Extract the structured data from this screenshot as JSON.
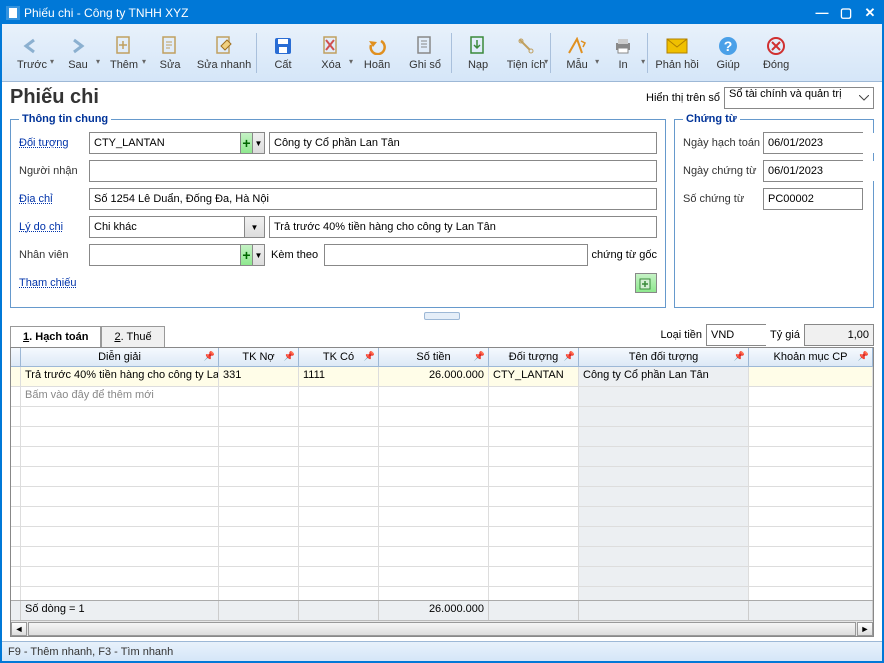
{
  "window": {
    "title": "Phiếu chi - Công ty TNHH XYZ"
  },
  "toolbar": {
    "prev": "Trước",
    "next": "Sau",
    "add": "Thêm",
    "edit": "Sửa",
    "quickedit": "Sửa nhanh",
    "cut": "Cất",
    "delete": "Xóa",
    "undo": "Hoãn",
    "post": "Ghi sổ",
    "load": "Nạp",
    "utility": "Tiện ích",
    "template": "Mẫu",
    "print": "In",
    "feedback": "Phản hồi",
    "help": "Giúp",
    "close": "Đóng"
  },
  "page": {
    "title": "Phiếu chi",
    "displayLabel": "Hiển thị trên sổ",
    "displayValue": "Sổ tài chính và quản trị"
  },
  "general": {
    "legend": "Thông tin chung",
    "subjectLabel": "Đối tượng",
    "subjectCode": "CTY_LANTAN",
    "subjectName": "Công ty Cổ phần Lan Tân",
    "receiverLabel": "Người nhận",
    "receiver": "",
    "addressLabel": "Địa chỉ",
    "address": "Số 1254 Lê Duẩn, Đống Đa, Hà Nội",
    "reasonLabel": "Lý do chi",
    "reasonCode": "Chi khác",
    "reasonText": "Trả trước 40% tiền hàng cho công ty Lan Tân",
    "employeeLabel": "Nhân viên",
    "employee": "",
    "attachLabel": "Kèm theo",
    "attachValue": "",
    "attachSuffix": "chứng từ gốc",
    "refLabel": "Tham chiếu"
  },
  "voucher": {
    "legend": "Chứng từ",
    "postDateLabel": "Ngày hạch toán",
    "postDate": "06/01/2023",
    "voucherDateLabel": "Ngày chứng từ",
    "voucherDate": "06/01/2023",
    "voucherNoLabel": "Số chứng từ",
    "voucherNo": "PC00002"
  },
  "tabs": {
    "tab1": "Hạch toán",
    "tab2": "Thuế",
    "acc1": "1",
    "acc2": "2"
  },
  "currency": {
    "label": "Loại tiền",
    "code": "VND",
    "rateLabel": "Tỷ giá",
    "rate": "1,00"
  },
  "grid": {
    "headers": {
      "dg": "Diễn giải",
      "tkno": "TK Nợ",
      "tkco": "TK Có",
      "sotien": "Số tiền",
      "dt": "Đối tượng",
      "tendt": "Tên đối tượng",
      "km": "Khoản mục CP"
    },
    "rows": [
      {
        "dg": "Trả trước 40% tiền hàng cho công ty La",
        "tkno": "331",
        "tkco": "1111",
        "sotien": "26.000.000",
        "dt": "CTY_LANTAN",
        "tendt": "Công ty Cổ phần Lan Tân",
        "km": ""
      }
    ],
    "placeholder": "Bấm vào đây để thêm mới",
    "footer": {
      "rows": "Số dòng = 1",
      "totalSotien": "26.000.000"
    }
  },
  "status": "F9 - Thêm nhanh, F3 - Tìm nhanh"
}
